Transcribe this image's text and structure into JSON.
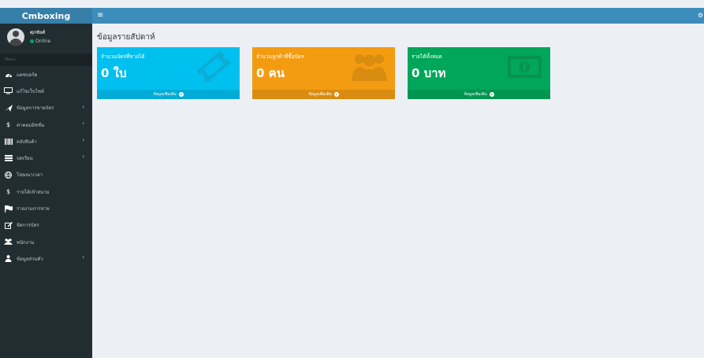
{
  "header": {
    "brand": "Cmboxing",
    "toggle_icon": "hamburger-icon",
    "right_icon": "gears-icon"
  },
  "user": {
    "name": "ศุภชัยศ์",
    "status": "Online"
  },
  "sidebar": {
    "header": "Menu",
    "items": [
      {
        "label": "แดชบอร์ด",
        "icon": "dashboard-icon",
        "has_chevron": false
      },
      {
        "label": "แก้ไขเว็บไซต์",
        "icon": "monitor-icon",
        "has_chevron": false
      },
      {
        "label": "ข้อมูลการขายบัตร",
        "icon": "plane-icon",
        "has_chevron": true
      },
      {
        "label": "ค่าคอมมิชชั่น",
        "icon": "dollar-icon",
        "has_chevron": true
      },
      {
        "label": "คลังสินค้า",
        "icon": "barcode-icon",
        "has_chevron": true
      },
      {
        "label": "บทเรียน",
        "icon": "list-icon",
        "has_chevron": true
      },
      {
        "label": "โฆษณาเวลา",
        "icon": "globe-icon",
        "has_chevron": false
      },
      {
        "label": "รายได้เข้าสนาม",
        "icon": "dollar-icon",
        "has_chevron": false
      },
      {
        "label": "รายงานการขาย",
        "icon": "flag-icon",
        "has_chevron": false
      },
      {
        "label": "จัดการบัตร",
        "icon": "edit-icon",
        "has_chevron": false
      },
      {
        "label": "พนักงาน",
        "icon": "users-icon",
        "has_chevron": false
      },
      {
        "label": "ข้อมูลส่วนตัว",
        "icon": "user-icon",
        "has_chevron": true
      }
    ]
  },
  "main": {
    "title": "ข้อมูลรายสัปดาห์",
    "boxes": [
      {
        "title": "จำนวนบัตรที่ขายได้",
        "value": "0 ใบ",
        "footer": "ข้อมูลเพิ่มเติม",
        "icon": "ticket-icon",
        "color": "#00c0ef"
      },
      {
        "title": "จำนวนลูกค้าที่ซื้อบัตร",
        "value": "0 คน",
        "footer": "ข้อมูลเพิ่มเติม",
        "icon": "users-icon",
        "color": "#f39c12"
      },
      {
        "title": "รายได้ทั้งหมด",
        "value": "0 บาท",
        "footer": "ข้อมูลเพิ่มเติม",
        "icon": "money-icon",
        "color": "#00a65a"
      }
    ]
  }
}
